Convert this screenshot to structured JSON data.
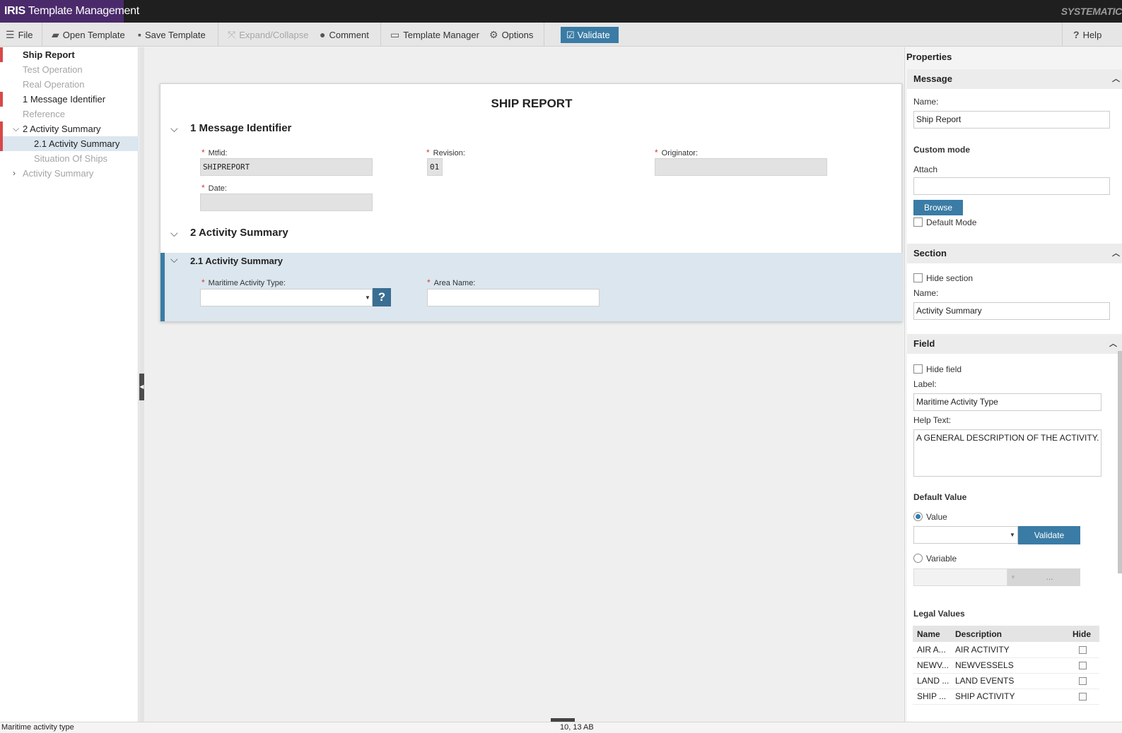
{
  "app": {
    "brand_bold": "IRIS",
    "brand_rest": " Template Management",
    "vendor": "SYSTEMATIC"
  },
  "toolbar": {
    "file": "File",
    "open": "Open Template",
    "save": "Save Template",
    "expand": "Expand/Collapse",
    "comment": "Comment",
    "manager": "Template Manager",
    "options": "Options",
    "validate": "Validate",
    "help": "Help"
  },
  "tree": {
    "items": [
      {
        "label": "Ship Report",
        "marked": true,
        "muted": false,
        "bold": true
      },
      {
        "label": "Test Operation",
        "marked": false,
        "muted": true
      },
      {
        "label": "Real Operation",
        "marked": false,
        "muted": true
      },
      {
        "label": "1 Message Identifier",
        "marked": true,
        "muted": false
      },
      {
        "label": "Reference",
        "marked": false,
        "muted": true
      },
      {
        "label": "2 Activity Summary",
        "marked": true,
        "muted": false,
        "expanded": true
      },
      {
        "label": "2.1 Activity Summary",
        "marked": true,
        "muted": false,
        "selected": true
      },
      {
        "label": "Situation Of Ships",
        "marked": false,
        "muted": true
      },
      {
        "label": "Activity Summary",
        "marked": false,
        "muted": true,
        "collapsed": true
      }
    ]
  },
  "doc": {
    "title": "SHIP REPORT",
    "sec1": {
      "title": "1 Message Identifier",
      "mtfid_label": "Mtfid:",
      "mtfid_value": "SHIPREPORT",
      "revision_label": "Revision:",
      "revision_value": "01",
      "originator_label": "Originator:",
      "date_label": "Date:"
    },
    "sec2": {
      "title": "2 Activity Summary",
      "sub_title": "2.1 Activity Summary",
      "mat_label": "Maritime Activity Type:",
      "help_glyph": "?",
      "area_label": "Area Name:"
    }
  },
  "props": {
    "title": "Properties",
    "message": {
      "header": "Message",
      "name_label": "Name:",
      "name_value": "Ship Report",
      "custom_mode": "Custom mode",
      "attach_label": "Attach",
      "browse": "Browse",
      "default_mode": "Default Mode"
    },
    "section": {
      "header": "Section",
      "hide_section": "Hide section",
      "name_label": "Name:",
      "name_value": "Activity Summary"
    },
    "field": {
      "header": "Field",
      "hide_field": "Hide field",
      "label_label": "Label:",
      "label_value": "Maritime Activity Type",
      "help_label": "Help Text:",
      "help_value": "A GENERAL DESCRIPTION OF THE ACTIVITY.",
      "default_value": "Default Value",
      "value_radio": "Value",
      "validate": "Validate",
      "variable_radio": "Variable",
      "ellipsis": "...",
      "legal_values": "Legal Values",
      "columns": [
        "Name",
        "Description",
        "Hide"
      ],
      "rows": [
        {
          "name": "AIR A...",
          "description": "AIR ACTIVITY"
        },
        {
          "name": "NEWV...",
          "description": "NEWVESSELS"
        },
        {
          "name": "LAND ...",
          "description": "LAND EVENTS"
        },
        {
          "name": "SHIP ...",
          "description": "SHIP ACTIVITY"
        }
      ]
    }
  },
  "status": {
    "left": "Maritime activity type",
    "mid": "10, 13 AB"
  }
}
